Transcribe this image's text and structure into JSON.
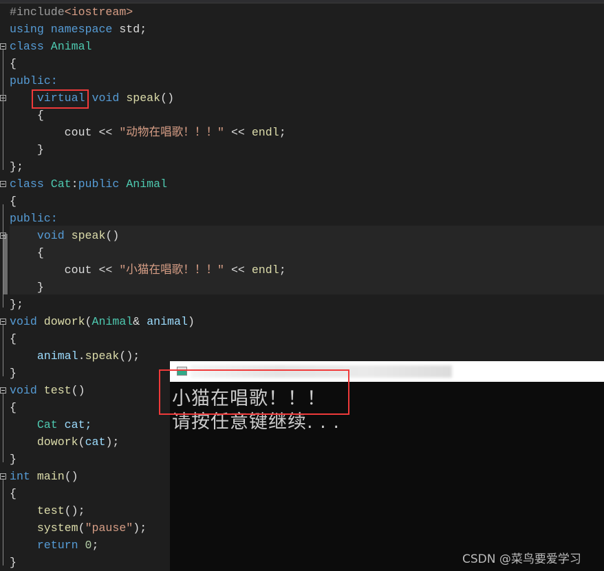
{
  "code_lines": [
    {
      "fold": false,
      "tokens": [
        [
          "#include",
          "pp"
        ],
        [
          "<iostream>",
          "st"
        ]
      ]
    },
    {
      "fold": false,
      "tokens": [
        [
          "using ",
          "kw"
        ],
        [
          "namespace ",
          "kw"
        ],
        [
          "std;",
          "pl"
        ]
      ]
    },
    {
      "fold": true,
      "tokens": [
        [
          "class ",
          "kw"
        ],
        [
          "Animal",
          "ty"
        ]
      ]
    },
    {
      "fold": false,
      "tokens": [
        [
          "{",
          "pl"
        ]
      ]
    },
    {
      "fold": false,
      "tokens": [
        [
          "public:",
          "kw"
        ]
      ]
    },
    {
      "fold": true,
      "tokens": [
        [
          "    ",
          "pl"
        ],
        [
          "virtual",
          "kw"
        ],
        [
          " void ",
          "kw"
        ],
        [
          "speak",
          "fn"
        ],
        [
          "()",
          "pl"
        ]
      ]
    },
    {
      "fold": false,
      "tokens": [
        [
          "    {",
          "pl"
        ]
      ]
    },
    {
      "fold": false,
      "tokens": [
        [
          "        cout << ",
          "pl"
        ],
        [
          "\"动物在唱歌！！！\"",
          "st"
        ],
        [
          " << ",
          "pl"
        ],
        [
          "endl",
          "fn"
        ],
        [
          ";",
          "pl"
        ]
      ]
    },
    {
      "fold": false,
      "tokens": [
        [
          "    }",
          "pl"
        ]
      ]
    },
    {
      "fold": false,
      "tokens": [
        [
          "};",
          "pl"
        ]
      ]
    },
    {
      "fold": true,
      "tokens": [
        [
          "class ",
          "kw"
        ],
        [
          "Cat",
          "ty"
        ],
        [
          ":",
          "pl"
        ],
        [
          "public ",
          "kw"
        ],
        [
          "Animal",
          "ty"
        ]
      ]
    },
    {
      "fold": false,
      "tokens": [
        [
          "{",
          "pl"
        ]
      ]
    },
    {
      "fold": false,
      "tokens": [
        [
          "public:",
          "kw"
        ]
      ]
    },
    {
      "fold": true,
      "tokens": [
        [
          "    void ",
          "kw"
        ],
        [
          "speak",
          "fn"
        ],
        [
          "()",
          "pl"
        ]
      ]
    },
    {
      "fold": false,
      "tokens": [
        [
          "    {",
          "pl"
        ]
      ]
    },
    {
      "fold": false,
      "tokens": [
        [
          "        cout << ",
          "pl"
        ],
        [
          "\"小猫在唱歌！！！\"",
          "st"
        ],
        [
          " << ",
          "pl"
        ],
        [
          "endl",
          "fn"
        ],
        [
          ";",
          "pl"
        ]
      ]
    },
    {
      "fold": false,
      "tokens": [
        [
          "    }",
          "pl"
        ]
      ]
    },
    {
      "fold": false,
      "tokens": [
        [
          "};",
          "pl"
        ]
      ]
    },
    {
      "fold": true,
      "tokens": [
        [
          "void ",
          "kw"
        ],
        [
          "dowork",
          "fn"
        ],
        [
          "(",
          "pl"
        ],
        [
          "Animal",
          "ty"
        ],
        [
          "& ",
          "pl"
        ],
        [
          "animal",
          "pa"
        ],
        [
          ")",
          "pl"
        ]
      ]
    },
    {
      "fold": false,
      "tokens": [
        [
          "{",
          "pl"
        ]
      ]
    },
    {
      "fold": false,
      "tokens": [
        [
          "    animal",
          "pa"
        ],
        [
          ".",
          "pl"
        ],
        [
          "speak",
          "fn"
        ],
        [
          "();",
          "pl"
        ]
      ]
    },
    {
      "fold": false,
      "tokens": [
        [
          "}",
          "pl"
        ]
      ]
    },
    {
      "fold": true,
      "tokens": [
        [
          "void ",
          "kw"
        ],
        [
          "test",
          "fn"
        ],
        [
          "()",
          "pl"
        ]
      ]
    },
    {
      "fold": false,
      "tokens": [
        [
          "{",
          "pl"
        ]
      ]
    },
    {
      "fold": false,
      "tokens": [
        [
          "    Cat ",
          "ty"
        ],
        [
          "cat;",
          "pa"
        ]
      ]
    },
    {
      "fold": false,
      "tokens": [
        [
          "    dowork",
          "fn"
        ],
        [
          "(",
          "pl"
        ],
        [
          "cat",
          "pa"
        ],
        [
          ");",
          "pl"
        ]
      ]
    },
    {
      "fold": false,
      "tokens": [
        [
          "}",
          "pl"
        ]
      ]
    },
    {
      "fold": true,
      "tokens": [
        [
          "int ",
          "kw"
        ],
        [
          "main",
          "fn"
        ],
        [
          "()",
          "pl"
        ]
      ]
    },
    {
      "fold": false,
      "tokens": [
        [
          "{",
          "pl"
        ]
      ]
    },
    {
      "fold": false,
      "tokens": [
        [
          "    test",
          "fn"
        ],
        [
          "();",
          "pl"
        ]
      ]
    },
    {
      "fold": false,
      "tokens": [
        [
          "    system",
          "fn"
        ],
        [
          "(",
          "pl"
        ],
        [
          "\"pause\"",
          "st"
        ],
        [
          ");",
          "pl"
        ]
      ]
    },
    {
      "fold": false,
      "tokens": [
        [
          "    return ",
          "kw"
        ],
        [
          "0",
          "nu"
        ],
        [
          ";",
          "pl"
        ]
      ]
    },
    {
      "fold": false,
      "tokens": [
        [
          "}",
          "pl"
        ]
      ]
    }
  ],
  "console": {
    "output_line_1": "小猫在唱歌！！！",
    "output_line_2": "请按任意键继续. . ."
  },
  "watermark": "CSDN @菜鸟要爱学习",
  "colors": {
    "background": "#1e1e1e",
    "keyword": "#569cd6",
    "type": "#4ec9b0",
    "function": "#dcdcaa",
    "string": "#d69d85",
    "highlight_box": "#f03a3a"
  }
}
